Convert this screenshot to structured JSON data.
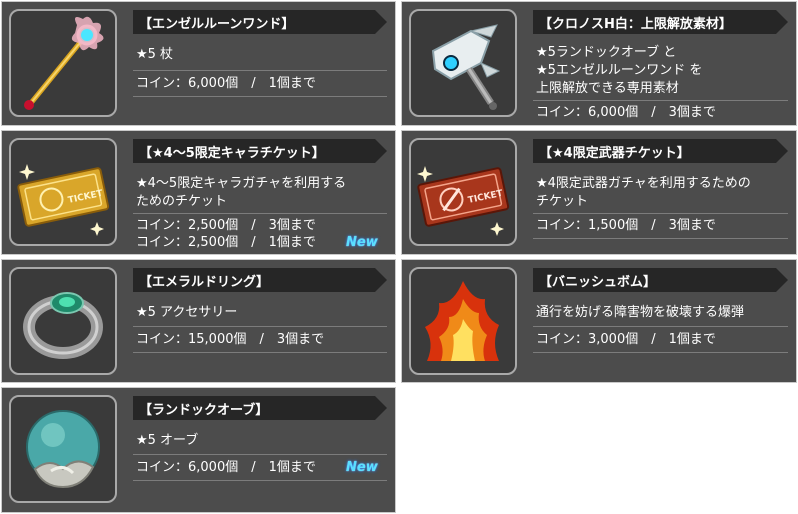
{
  "items": [
    {
      "title": "【エンゼルルーンワンド】",
      "desc": "★5 杖",
      "costs": [
        "コイン：6,000個　/　1個まで"
      ],
      "icon": "angel-rune-wand-icon"
    },
    {
      "title": "【クロノスH白：上限解放素材】",
      "desc": "★5ランドックオーブ と\n★5エンゼルルーンワンド を\n上限解放できる専用素材",
      "costs": [
        "コイン：6,000個　/　3個まで"
      ],
      "icon": "kronos-h-white-icon"
    },
    {
      "title": "【★4～5限定キャラチケット】",
      "desc": "★4～5限定キャラガチャを利用する\nためのチケット",
      "costs": [
        "コイン：2,500個　/　3個まで",
        "コイン：2,500個　/　1個まで"
      ],
      "new_label": "New",
      "icon": "gold-ticket-icon"
    },
    {
      "title": "【★4限定武器チケット】",
      "desc": "★4限定武器ガチャを利用するための\nチケット",
      "costs": [
        "コイン：1,500個　/　3個まで"
      ],
      "icon": "red-ticket-icon"
    },
    {
      "title": "【エメラルドリング】",
      "desc": "★5 アクセサリー",
      "costs": [
        "コイン：15,000個　/　3個まで"
      ],
      "icon": "emerald-ring-icon"
    },
    {
      "title": "【バニッシュボム】",
      "desc": "通行を妨げる障害物を破壊する爆弾",
      "costs": [
        "コイン：3,000個　/　1個まで"
      ],
      "icon": "vanish-bomb-icon"
    },
    {
      "title": "【ランドックオーブ】",
      "desc": "★5 オーブ",
      "costs": [
        "コイン：6,000個　/　1個まで"
      ],
      "new_label": "New",
      "icon": "landock-orb-icon"
    }
  ]
}
